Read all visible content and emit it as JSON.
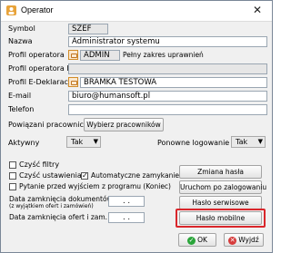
{
  "window": {
    "title": "Operator",
    "close_glyph": "✕"
  },
  "form": {
    "symbol": {
      "label": "Symbol",
      "value": "SZEF"
    },
    "nazwa": {
      "label": "Nazwa",
      "value": "Administrator systemu"
    },
    "profil_operatora": {
      "label": "Profil operatora",
      "value": "ADMIN",
      "description": "Pełny zakres uprawnień"
    },
    "profil_operatora_kh": {
      "label": "Profil operatora KH",
      "value": ""
    },
    "profil_edeklaracji": {
      "label": "Profil E-Deklaracji",
      "value": "BRAMKA TESTOWA"
    },
    "email": {
      "label": "E-mail",
      "value": "biuro@humansoft.pl"
    },
    "telefon": {
      "label": "Telefon",
      "value": ""
    },
    "powiazani": {
      "label": "Powiązani pracownicy",
      "button": "Wybierz pracowników"
    },
    "aktywny": {
      "label": "Aktywny",
      "value": "Tak"
    },
    "ponowne_logowanie": {
      "label": "Ponowne logowanie",
      "value": "Tak"
    }
  },
  "checkboxes": {
    "czysc_filtry": {
      "label": "Czyść filtry",
      "checked": false
    },
    "czysc_ustawienia": {
      "label": "Czyść ustawienia",
      "checked": false
    },
    "automatyczne_zamykanie": {
      "label": "Automatyczne zamykanie",
      "checked": true
    },
    "pytanie_przed_wyjsciem": {
      "label": "Pytanie przed wyjściem z programu (Koniec)",
      "checked": false
    }
  },
  "dates": {
    "zamkniecia_dokumentow": {
      "label": "Data zamknięcia dokumentów",
      "sublabel": "(z wyjątkiem ofert i zamówień)",
      "value": ". ."
    },
    "zamkniecia_ofert": {
      "label": "Data zamknięcia ofert i zam.",
      "value": ". ."
    }
  },
  "buttons": {
    "zmiana_hasla": "Zmiana hasła",
    "uruchom_po_zalogowaniu": "Uruchom po zalogowaniu",
    "haslo_serwisowe": "Hasło serwisowe",
    "haslo_mobilne": "Hasło mobilne",
    "ok": "OK",
    "wyjdz": "Wyjdź"
  },
  "colors": {
    "highlight": "#d9262b",
    "ok_icon": "#2aa53a",
    "exit_icon": "#d63b3b"
  },
  "icons": {
    "app": "operator-app-icon",
    "ok": "check-icon",
    "exit": "x-icon",
    "lookup": "lookup-icon"
  }
}
